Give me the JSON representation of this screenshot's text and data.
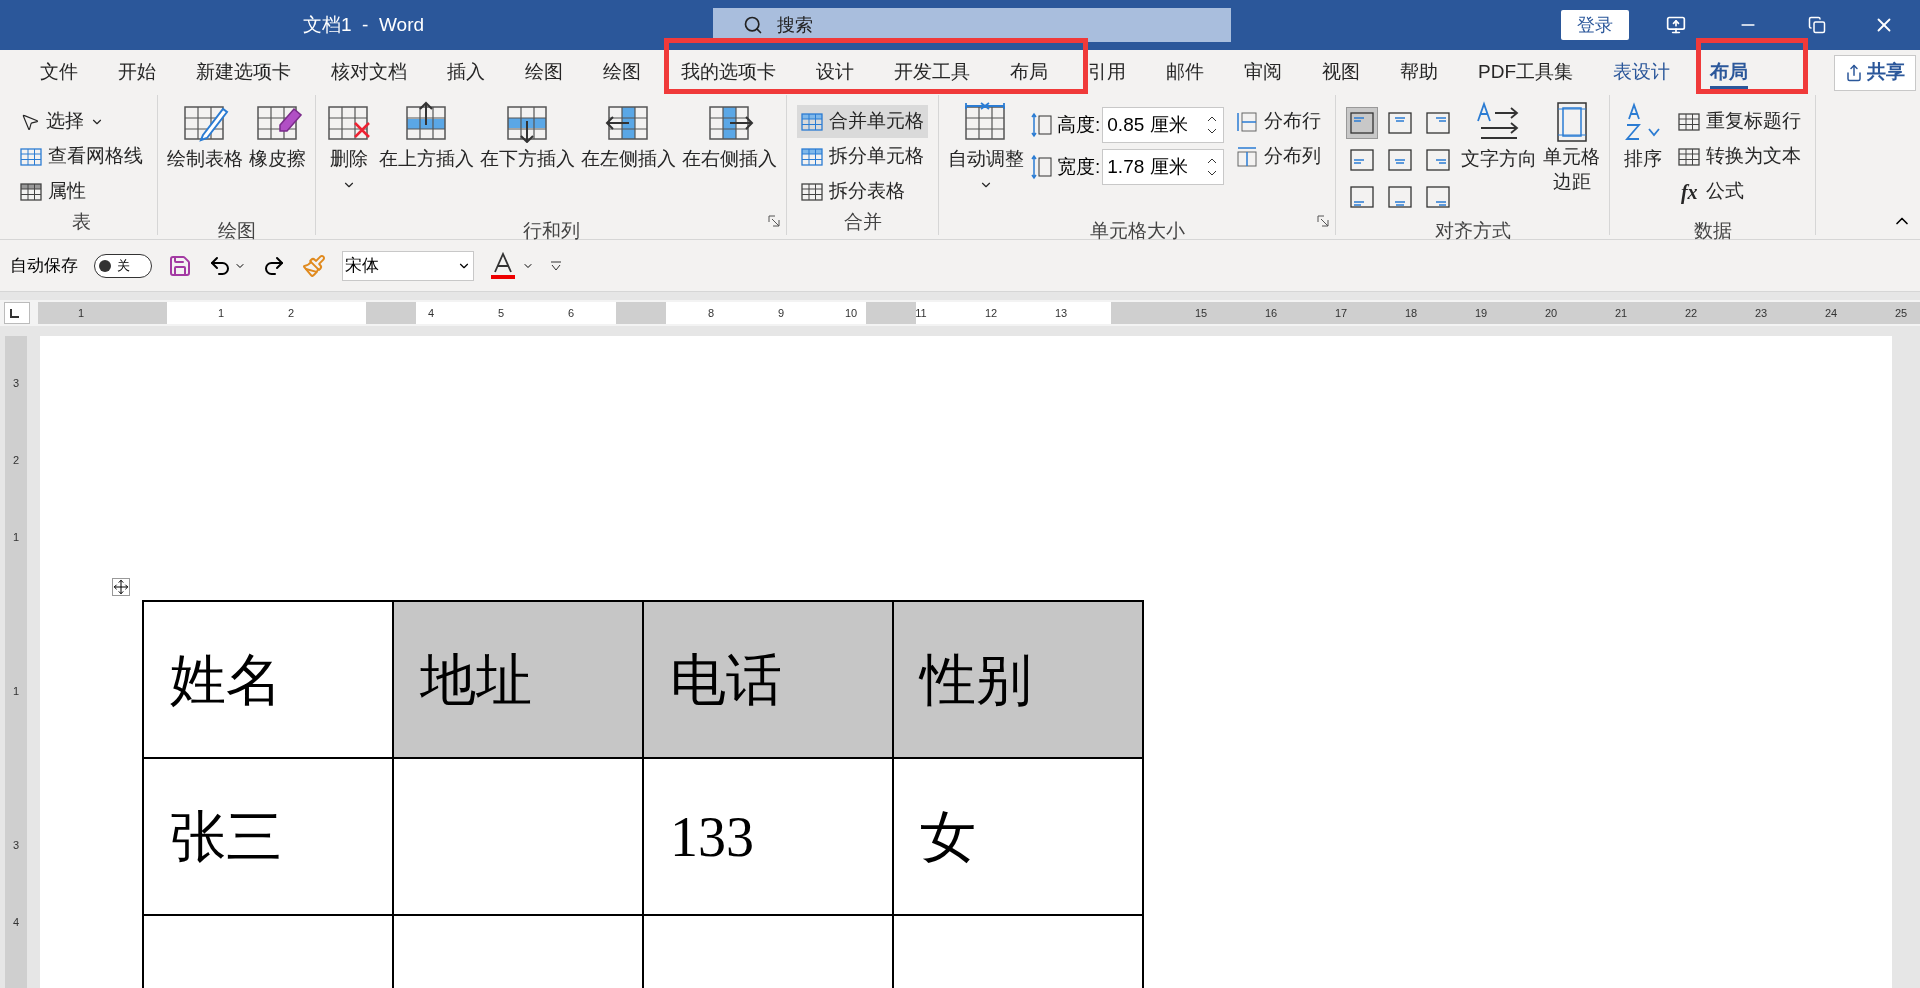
{
  "title_bar": {
    "title": "文档1  -  Word",
    "search": {
      "placeholder": "搜索"
    },
    "login_button": "登录"
  },
  "tabs": [
    {
      "label": "文件",
      "selected": false,
      "contextual": false
    },
    {
      "label": "开始",
      "selected": false,
      "contextual": false
    },
    {
      "label": "新建选项卡",
      "selected": false,
      "contextual": false
    },
    {
      "label": "核对文档",
      "selected": false,
      "contextual": false
    },
    {
      "label": "插入",
      "selected": false,
      "contextual": false
    },
    {
      "label": "绘图",
      "selected": false,
      "contextual": false
    },
    {
      "label": "绘图",
      "selected": false,
      "contextual": false
    },
    {
      "label": "我的选项卡",
      "selected": false,
      "contextual": false
    },
    {
      "label": "设计",
      "selected": false,
      "contextual": false
    },
    {
      "label": "开发工具",
      "selected": false,
      "contextual": false
    },
    {
      "label": "布局",
      "selected": false,
      "contextual": false
    },
    {
      "label": "引用",
      "selected": false,
      "contextual": false
    },
    {
      "label": "邮件",
      "selected": false,
      "contextual": false
    },
    {
      "label": "审阅",
      "selected": false,
      "contextual": false
    },
    {
      "label": "视图",
      "selected": false,
      "contextual": false
    },
    {
      "label": "帮助",
      "selected": false,
      "contextual": false
    },
    {
      "label": "PDF工具集",
      "selected": false,
      "contextual": false
    },
    {
      "label": "表设计",
      "selected": false,
      "contextual": true
    },
    {
      "label": "布局",
      "selected": true,
      "contextual": true
    }
  ],
  "share_button": "共享",
  "ribbon_groups": [
    {
      "label": "表",
      "launcher": false,
      "items": [
        {
          "kind": "small",
          "label": "选择",
          "caret": true,
          "highlighted": false
        },
        {
          "kind": "small",
          "label": "查看网格线",
          "caret": false,
          "highlighted": false
        },
        {
          "kind": "small",
          "label": "属性",
          "caret": false,
          "highlighted": false
        }
      ]
    },
    {
      "label": "绘图",
      "launcher": false,
      "items": [
        {
          "kind": "large",
          "label": "绘制表格",
          "caret": false
        },
        {
          "kind": "large",
          "label": "橡皮擦",
          "caret": false
        }
      ]
    },
    {
      "label": "行和列",
      "launcher": true,
      "items": [
        {
          "kind": "large",
          "label": "删除",
          "caret": true
        },
        {
          "kind": "large",
          "label": "在上方插入",
          "caret": false
        },
        {
          "kind": "large",
          "label": "在下方插入",
          "caret": false
        },
        {
          "kind": "large",
          "label": "在左侧插入",
          "caret": false
        },
        {
          "kind": "large",
          "label": "在右侧插入",
          "caret": false
        }
      ]
    },
    {
      "label": "合并",
      "launcher": false,
      "items": [
        {
          "kind": "small",
          "label": "合并单元格",
          "caret": false,
          "highlighted": true
        },
        {
          "kind": "small",
          "label": "拆分单元格",
          "caret": false,
          "highlighted": false
        },
        {
          "kind": "small",
          "label": "拆分表格",
          "caret": false,
          "highlighted": false
        }
      ]
    },
    {
      "label": "单元格大小",
      "launcher": true,
      "items": [
        {
          "kind": "large",
          "label": "自动调整",
          "caret": true
        },
        {
          "kind": "field",
          "label": "高度:",
          "value": "0.85 厘米"
        },
        {
          "kind": "field",
          "label": "宽度:",
          "value": "1.78 厘米"
        },
        {
          "kind": "small",
          "label": "分布行",
          "caret": false,
          "highlighted": false
        },
        {
          "kind": "small",
          "label": "分布列",
          "caret": false,
          "highlighted": false
        }
      ]
    },
    {
      "label": "对齐方式",
      "launcher": false,
      "items": [
        {
          "kind": "align",
          "buttons": [
            {
              "selected": true
            },
            {
              "selected": false
            },
            {
              "selected": false
            },
            {
              "selected": false
            },
            {
              "selected": false
            },
            {
              "selected": false
            },
            {
              "selected": false
            },
            {
              "selected": false
            },
            {
              "selected": false
            }
          ]
        },
        {
          "kind": "large",
          "label": "文字方向",
          "caret": false
        },
        {
          "kind": "large",
          "label": "单元格边距",
          "caret": false
        }
      ]
    },
    {
      "label": "数据",
      "launcher": false,
      "items": [
        {
          "kind": "large",
          "label": "排序",
          "caret": false
        },
        {
          "kind": "small",
          "label": "重复标题行",
          "caret": false,
          "highlighted": false
        },
        {
          "kind": "small",
          "label": "转换为文本",
          "caret": false,
          "highlighted": false
        },
        {
          "kind": "small",
          "label": "公式",
          "caret": false,
          "highlighted": false,
          "icon_text": "fx"
        }
      ]
    }
  ],
  "quick_access": {
    "autosave": {
      "label": "自动保存",
      "on": false,
      "state_label": "关"
    },
    "font": {
      "value": "宋体"
    }
  },
  "ruler": [
    {
      "kind": "number",
      "label": "1"
    },
    {
      "kind": "gap"
    },
    {
      "kind": "number",
      "label": "1"
    },
    {
      "kind": "number",
      "label": "2"
    },
    {
      "kind": "gap"
    },
    {
      "kind": "number",
      "label": "4"
    },
    {
      "kind": "number",
      "label": "5"
    },
    {
      "kind": "number",
      "label": "6"
    },
    {
      "kind": "gap"
    },
    {
      "kind": "number",
      "label": "8"
    },
    {
      "kind": "number",
      "label": "9"
    },
    {
      "kind": "number",
      "label": "10"
    },
    {
      "kind": "number",
      "label": "11"
    },
    {
      "kind": "number",
      "label": "12"
    },
    {
      "kind": "number",
      "label": "13"
    },
    {
      "kind": "gap"
    },
    {
      "kind": "number",
      "label": "15"
    },
    {
      "kind": "number",
      "label": "16"
    },
    {
      "kind": "number",
      "label": "17"
    },
    {
      "kind": "number",
      "label": "18"
    },
    {
      "kind": "number",
      "label": "19"
    },
    {
      "kind": "number",
      "label": "20"
    },
    {
      "kind": "number",
      "label": "21"
    },
    {
      "kind": "number",
      "label": "22"
    },
    {
      "kind": "number",
      "label": "23"
    },
    {
      "kind": "number",
      "label": "24"
    },
    {
      "kind": "number",
      "label": "25"
    }
  ],
  "vertical_ruler": [
    {
      "kind": "number",
      "label": "3"
    },
    {
      "kind": "number",
      "label": "2"
    },
    {
      "kind": "number",
      "label": "1"
    },
    {
      "kind": "gap"
    },
    {
      "kind": "number",
      "label": "1"
    },
    {
      "kind": "gap"
    },
    {
      "kind": "number",
      "label": "3"
    },
    {
      "kind": "number",
      "label": "4"
    }
  ],
  "table": {
    "rows": [
      {
        "cells": [
          {
            "text": "姓名",
            "selected": false
          },
          {
            "text": "地址",
            "selected": true
          },
          {
            "text": "电话",
            "selected": true
          },
          {
            "text": "性别",
            "selected": true
          }
        ]
      },
      {
        "cells": [
          {
            "text": "张三",
            "selected": false
          },
          {
            "selected": false
          },
          {
            "text": "133",
            "selected": false
          },
          {
            "text": "女",
            "selected": false
          }
        ]
      },
      {
        "cells": [
          {
            "selected": false
          },
          {
            "selected": false
          },
          {
            "selected": false
          },
          {
            "selected": false
          }
        ]
      }
    ]
  }
}
